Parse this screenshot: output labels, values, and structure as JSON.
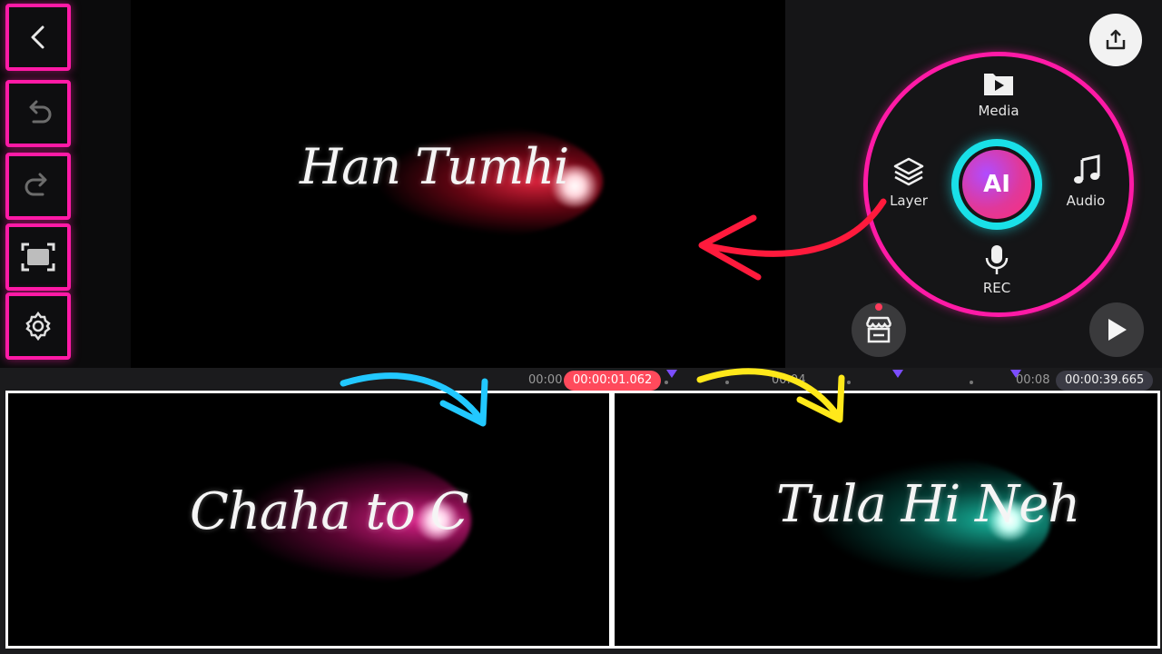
{
  "toolbar": {
    "items": [
      {
        "name": "back",
        "icon": "chevron-left-icon"
      },
      {
        "name": "undo",
        "icon": "undo-icon"
      },
      {
        "name": "redo",
        "icon": "redo-icon"
      },
      {
        "name": "fullscreen",
        "icon": "fullscreen-icon"
      },
      {
        "name": "settings",
        "icon": "gear-icon"
      }
    ],
    "accent": "#ff1aa6"
  },
  "preview": {
    "text": "Han Tumhi"
  },
  "menu": {
    "media_label": "Media",
    "layer_label": "Layer",
    "audio_label": "Audio",
    "rec_label": "REC",
    "ai_label": "AI",
    "ring_color": "#ff1aa6",
    "ai_ring_color": "#19e0e8"
  },
  "timeline": {
    "start_time": "00:00",
    "current_time": "00:00:01.062",
    "mid_time": "00:04",
    "end_marker_time": "00:08",
    "total_time": "00:00:39.665"
  },
  "frames": {
    "left_text": "Chaha to C",
    "right_text": "Tula Hi Neh",
    "arrow_left_color": "#22c8ff",
    "arrow_right_color": "#ffe81a",
    "preview_arrow_color": "#ff1a3c"
  }
}
